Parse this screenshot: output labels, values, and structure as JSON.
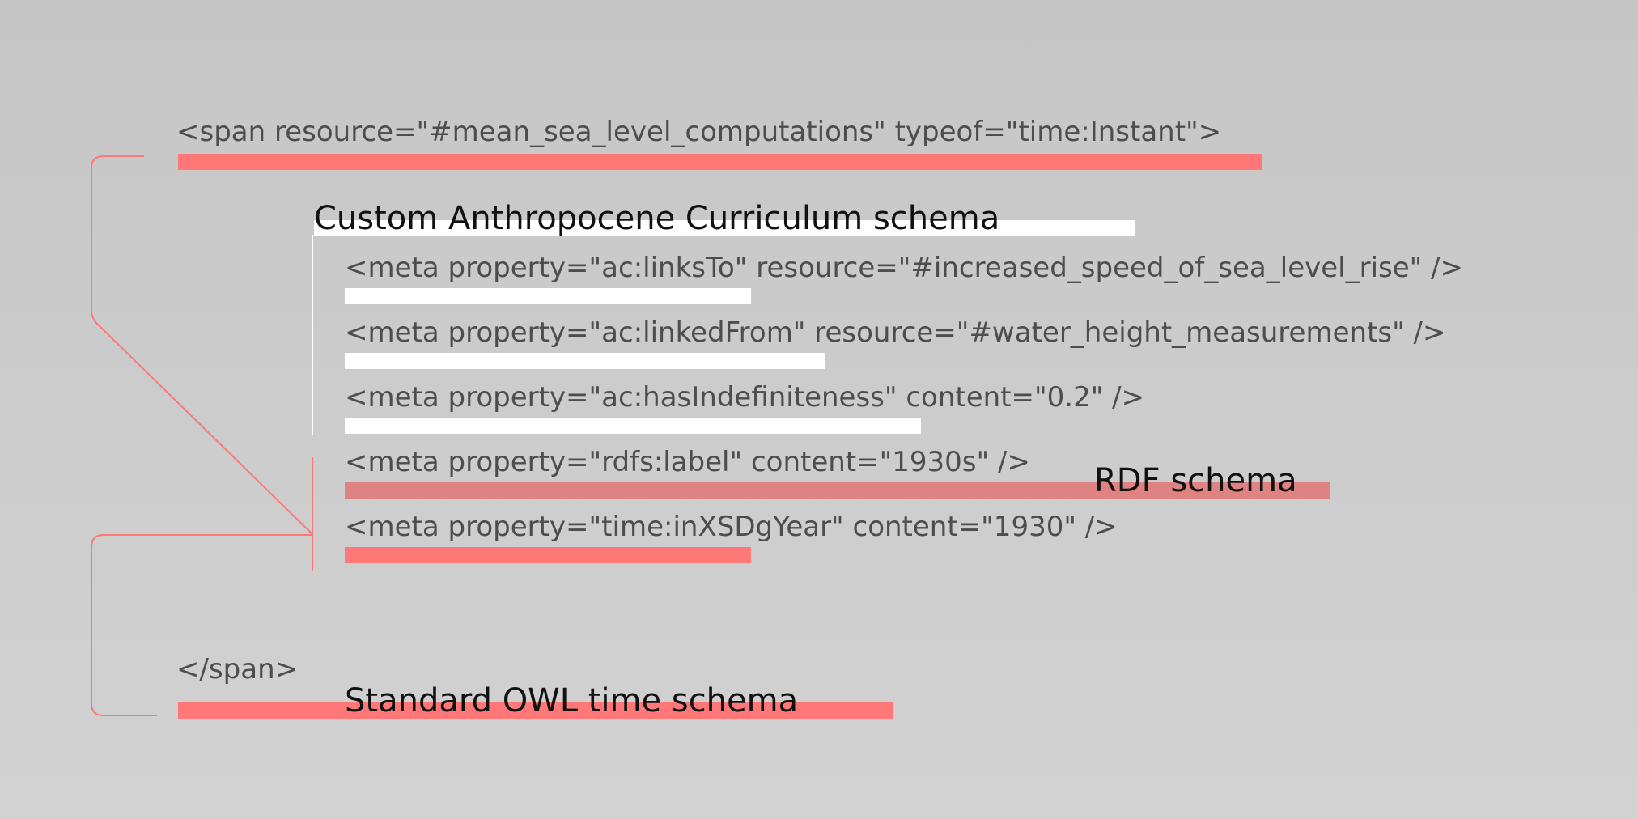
{
  "code_lines": {
    "span_open": "<span resource=\"#mean_sea_level_computations\" typeof=\"time:Instant\">",
    "meta_links_to": "<meta property=\"ac:linksTo\" resource=\"#increased_speed_of_sea_level_rise\" />",
    "meta_linked_from": "<meta property=\"ac:linkedFrom\" resource=\"#water_height_measurements\" />",
    "meta_has_indefiniteness": "<meta property=\"ac:hasIndefiniteness\" content=\"0.2\" />",
    "meta_rdfs_label": "<meta property=\"rdfs:label\" content=\"1930s\" />",
    "meta_in_xsd_g_year": "<meta property=\"time:inXSDgYear\" content=\"1930\" />",
    "span_close": "</span>"
  },
  "labels": {
    "custom_schema": "Custom Anthropocene Curriculum schema",
    "rdf_schema": "RDF schema",
    "owl_time_schema": "Standard OWL time schema"
  },
  "colors": {
    "owl_time": "#ff7777",
    "rdf": "#df8282",
    "custom": "#ffffff",
    "code_text": "#4d4d4d",
    "label_text": "#111111"
  }
}
